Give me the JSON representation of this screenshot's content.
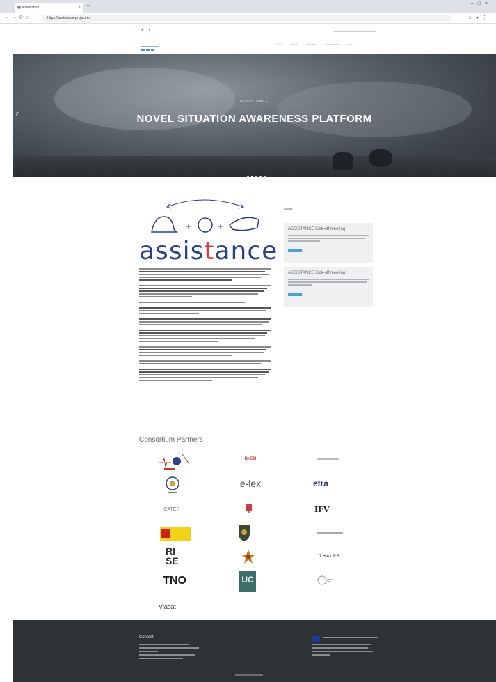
{
  "browser": {
    "tab_title": "Assistance",
    "url": "https://assistance-project.eu"
  },
  "hero": {
    "kicker": "ASSISTANCE",
    "headline": "NOVEL SITUATION AWARENESS PLATFORM",
    "slide_count": 5,
    "active_slide": 2
  },
  "brand": {
    "pre": "assis",
    "highlight": "t",
    "post": "ance"
  },
  "sidebar": {
    "title": "News",
    "items": [
      {
        "title": "ASSISTANCE Kick-off meeting"
      },
      {
        "title": "ASSISTANCE Kick-off meeting"
      }
    ]
  },
  "partners": {
    "title": "Consortium Partners",
    "logos": [
      "e-lex",
      "etra",
      "IFV",
      "RI SE",
      "THALES",
      "TNO",
      "UC",
      "Viasat"
    ]
  },
  "footer": {
    "contact_title": "Contact"
  },
  "colors": {
    "brand_blue": "#2b3f8c",
    "brand_red": "#d43d3d",
    "accent": "#4aa3d6",
    "footer_bg": "#2f3234"
  }
}
